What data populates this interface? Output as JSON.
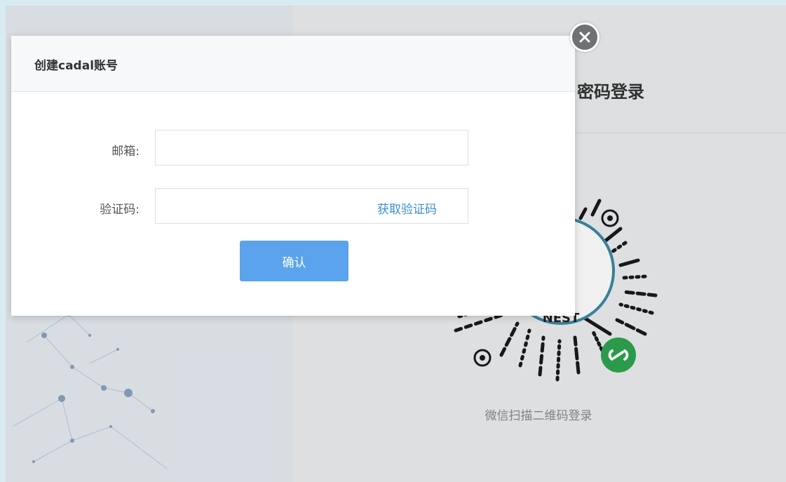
{
  "dialog": {
    "title": "创建cadal账号",
    "email_label": "邮箱:",
    "email_value": "",
    "email_placeholder": "",
    "code_label": "验证码:",
    "code_value": "",
    "code_placeholder": "",
    "get_code_link": "获取验证码",
    "confirm_label": "确认",
    "close_icon": "close-icon"
  },
  "login_panel": {
    "title_partial": "密码登录",
    "qr_caption": "微信扫描二维码登录",
    "qr_icon": "wechat-mini-program-code",
    "mini_program_icon": "link-icon"
  },
  "colors": {
    "accent": "#5ba3ec",
    "link": "#3b8fd5",
    "mini_program_green": "#2ea44f",
    "qr_ring": "#3d87a5"
  }
}
